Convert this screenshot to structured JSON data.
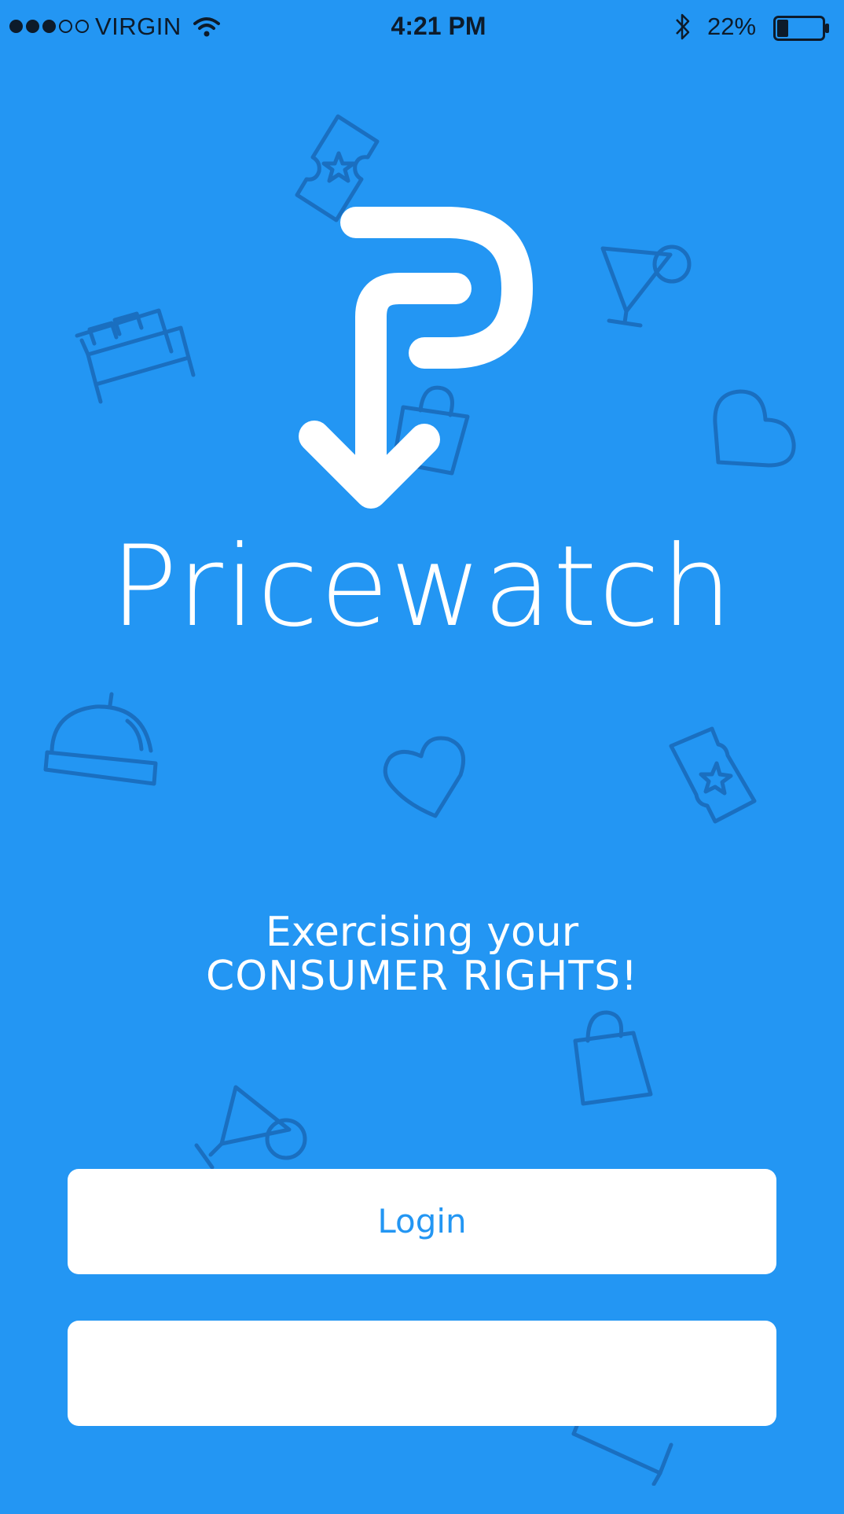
{
  "status_bar": {
    "signal_bars_filled": 3,
    "signal_bars_total": 5,
    "carrier": "VIRGIN",
    "time": "4:21 PM",
    "battery_percent": "22%",
    "battery_level": 0.22,
    "icons": [
      "wifi-icon",
      "bluetooth-icon",
      "battery-icon"
    ]
  },
  "brand": {
    "name": "Pricewatch",
    "logo_icon": "pricewatch-p-arrow-logo"
  },
  "tagline": {
    "line1": "Exercising your",
    "line2": "CONSUMER RIGHTS!"
  },
  "buttons": {
    "login_label": "Login",
    "second_label": ""
  },
  "background_icons": [
    "ticket-icon",
    "bed-icon",
    "cocktail-icon",
    "shopping-bag-icon",
    "heart-icon",
    "service-bell-icon",
    "heart-icon",
    "ticket-icon",
    "shopping-bag-icon",
    "cocktail-icon",
    "bed-icon"
  ],
  "colors": {
    "background": "#2396f3",
    "doodle": "#1a6fc0",
    "button": "#ffffff",
    "button_text": "#2396f3",
    "status_text": "#0d1b2a"
  }
}
